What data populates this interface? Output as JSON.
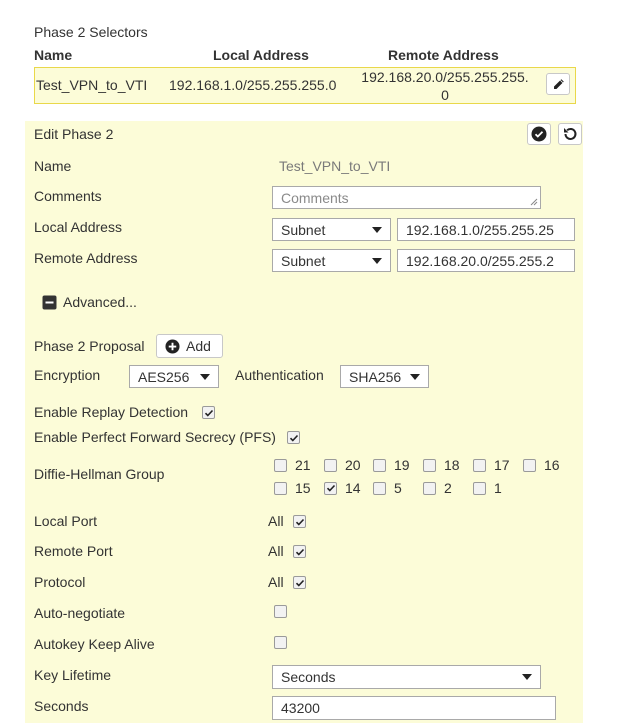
{
  "selectors": {
    "title": "Phase 2 Selectors",
    "col_name": "Name",
    "col_local": "Local Address",
    "col_remote": "Remote Address",
    "row": {
      "name": "Test_VPN_to_VTI",
      "local": "192.168.1.0/255.255.255.0",
      "remote_line1": "192.168.20.0/255.255.255.",
      "remote_line2": "0"
    }
  },
  "edit": {
    "title": "Edit Phase 2",
    "name_label": "Name",
    "name_value": "Test_VPN_to_VTI",
    "comments_label": "Comments",
    "comments_placeholder": "Comments",
    "local_label": "Local Address",
    "local_type": "Subnet",
    "local_value": "192.168.1.0/255.255.25",
    "remote_label": "Remote Address",
    "remote_type": "Subnet",
    "remote_value": "192.168.20.0/255.255.2",
    "advanced_label": "Advanced...",
    "proposal_label": "Phase 2 Proposal",
    "add_label": "Add",
    "encryption_label": "Encryption",
    "encryption_value": "AES256",
    "auth_label": "Authentication",
    "auth_value": "SHA256",
    "replay_label": "Enable Replay Detection",
    "replay_checked": true,
    "pfs_label": "Enable Perfect Forward Secrecy (PFS)",
    "pfs_checked": true,
    "dh_label": "Diffie-Hellman Group",
    "dh_groups": [
      {
        "label": "21",
        "checked": false
      },
      {
        "label": "20",
        "checked": false
      },
      {
        "label": "19",
        "checked": false
      },
      {
        "label": "18",
        "checked": false
      },
      {
        "label": "17",
        "checked": false
      },
      {
        "label": "16",
        "checked": false
      },
      {
        "label": "15",
        "checked": false
      },
      {
        "label": "14",
        "checked": true
      },
      {
        "label": "5",
        "checked": false
      },
      {
        "label": "2",
        "checked": false
      },
      {
        "label": "1",
        "checked": false
      }
    ],
    "local_port_label": "Local Port",
    "local_port_all": "All",
    "remote_port_label": "Remote Port",
    "remote_port_all": "All",
    "protocol_label": "Protocol",
    "protocol_all": "All",
    "autoneg_label": "Auto-negotiate",
    "keepalive_label": "Autokey Keep Alive",
    "key_lifetime_label": "Key Lifetime",
    "key_lifetime_value": "Seconds",
    "seconds_label": "Seconds",
    "seconds_value": "43200"
  }
}
